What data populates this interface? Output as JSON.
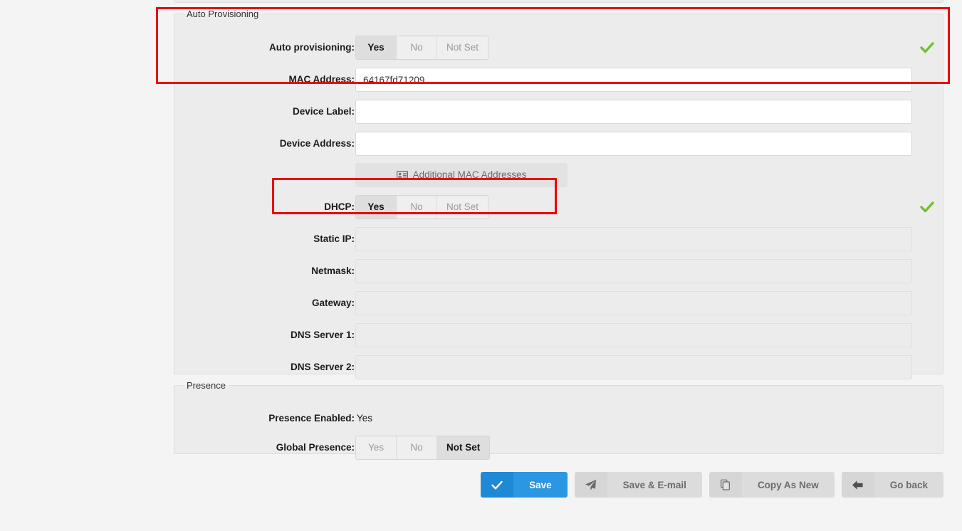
{
  "panels": {
    "auto_provisioning": {
      "legend": "Auto Provisioning",
      "rows": {
        "auto_provisioning": {
          "label": "Auto provisioning:",
          "options": [
            "Yes",
            "No",
            "Not Set"
          ],
          "selected": "Yes",
          "status_icon": "green-check-icon"
        },
        "mac_address": {
          "label": "MAC Address:",
          "value": "64167fd71209",
          "placeholder": ""
        },
        "device_label": {
          "label": "Device Label:",
          "value": "",
          "placeholder": ""
        },
        "device_address": {
          "label": "Device Address:",
          "value": "",
          "placeholder": ""
        },
        "additional_mac": {
          "label": "Additional MAC Addresses",
          "icon": "id-card-icon"
        },
        "dhcp": {
          "label": "DHCP:",
          "options": [
            "Yes",
            "No",
            "Not Set"
          ],
          "selected": "Yes",
          "status_icon": "green-check-icon"
        },
        "static_ip": {
          "label": "Static IP:",
          "value": "",
          "placeholder": "",
          "disabled": true
        },
        "netmask": {
          "label": "Netmask:",
          "value": "",
          "placeholder": "",
          "disabled": true
        },
        "gateway": {
          "label": "Gateway:",
          "value": "",
          "placeholder": "",
          "disabled": true
        },
        "dns_server_1": {
          "label": "DNS Server 1:",
          "value": "",
          "placeholder": "",
          "disabled": true
        },
        "dns_server_2": {
          "label": "DNS Server 2:",
          "value": "",
          "placeholder": "",
          "disabled": true
        }
      }
    },
    "presence": {
      "legend": "Presence",
      "rows": {
        "presence_enabled": {
          "label": "Presence Enabled:",
          "value": "Yes"
        },
        "global_presence": {
          "label": "Global Presence:",
          "options": [
            "Yes",
            "No",
            "Not Set"
          ],
          "selected": "Not Set"
        }
      }
    }
  },
  "buttons": {
    "save": {
      "label": "Save",
      "icon": "check-icon"
    },
    "save_email": {
      "label": "Save & E-mail",
      "icon": "paper-plane-icon"
    },
    "copy_as_new": {
      "label": "Copy As New",
      "icon": "copy-icon"
    },
    "go_back": {
      "label": "Go back",
      "icon": "arrow-left-icon"
    }
  },
  "colors": {
    "primary": "#2b96e2",
    "primary_dark": "#2089d6",
    "annotation": "#ee0000",
    "check_green": "#72c02c",
    "panel_bg": "#ececec",
    "page_bg": "#f4f4f4"
  }
}
